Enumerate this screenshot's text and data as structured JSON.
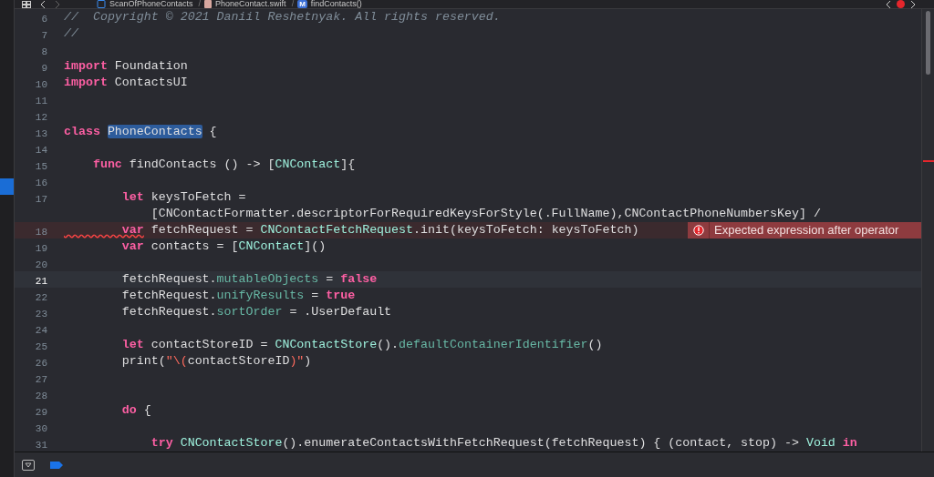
{
  "breadcrumb": {
    "items": [
      {
        "kind": "project",
        "label": "ScanOfPhoneContacts"
      },
      {
        "kind": "file",
        "separator": "/",
        "label": "PhoneContact.swift"
      },
      {
        "kind": "method",
        "separator": "/",
        "symbol": "M",
        "label": "findContacts()"
      }
    ]
  },
  "editor": {
    "rows": [
      {
        "number": "6",
        "current": false,
        "tokens": [
          {
            "kind": "comment",
            "text": "//  Copyright © 2021 Daniil Reshetnyak. All rights reserved."
          }
        ]
      },
      {
        "number": "7",
        "current": false,
        "tokens": [
          {
            "kind": "comment",
            "text": "//"
          }
        ]
      },
      {
        "number": "8",
        "current": false,
        "tokens": []
      },
      {
        "number": "9",
        "current": false,
        "tokens": [
          {
            "kind": "keyword",
            "text": "import"
          },
          {
            "kind": "plain",
            "text": " Foundation"
          }
        ]
      },
      {
        "number": "10",
        "current": false,
        "tokens": [
          {
            "kind": "keyword",
            "text": "import"
          },
          {
            "kind": "plain",
            "text": " ContactsUI"
          }
        ]
      },
      {
        "number": "11",
        "current": false,
        "tokens": []
      },
      {
        "number": "12",
        "current": false,
        "tokens": []
      },
      {
        "number": "13",
        "current": false,
        "tokens": [
          {
            "kind": "keyword",
            "text": "class "
          },
          {
            "kind": "selection",
            "text": "PhoneContacts"
          },
          {
            "kind": "plain",
            "text": " {"
          }
        ]
      },
      {
        "number": "14",
        "current": false,
        "tokens": []
      },
      {
        "number": "15",
        "current": false,
        "tokens": [
          {
            "kind": "keyword",
            "text": "    func"
          },
          {
            "kind": "plain",
            "text": " findContacts () -> ["
          },
          {
            "kind": "type",
            "text": "CNContact"
          },
          {
            "kind": "plain",
            "text": "]{"
          }
        ]
      },
      {
        "number": "16",
        "current": false,
        "tokens": []
      },
      {
        "number": "17",
        "current": false,
        "tokens": [
          {
            "kind": "keyword",
            "text": "        let"
          },
          {
            "kind": "plain",
            "text": " keysToFetch ="
          }
        ],
        "wrapped_tokens": [
          {
            "kind": "plain",
            "text": "            [CNContactFormatter.descriptorForRequiredKeysForStyle(.FullName),CNContactPhoneNumbersKey] /"
          }
        ]
      },
      {
        "number": "18",
        "current": false,
        "error": {
          "message": "Expected expression after operator"
        },
        "tokens": [
          {
            "kind": "keyword",
            "text": "        var"
          },
          {
            "kind": "plain",
            "text": " fetchRequest = "
          },
          {
            "kind": "type",
            "text": "CNContactFetchRequest"
          },
          {
            "kind": "plain",
            "text": ".init(keysToFetch: keysToFetch)"
          }
        ]
      },
      {
        "number": "19",
        "current": false,
        "tokens": [
          {
            "kind": "keyword",
            "text": "        var"
          },
          {
            "kind": "plain",
            "text": " contacts = ["
          },
          {
            "kind": "type",
            "text": "CNContact"
          },
          {
            "kind": "plain",
            "text": "]()"
          }
        ]
      },
      {
        "number": "20",
        "current": false,
        "tokens": []
      },
      {
        "number": "21",
        "current": true,
        "tokens": [
          {
            "kind": "plain",
            "text": "        fetchRequest."
          },
          {
            "kind": "property",
            "text": "mutableObjects"
          },
          {
            "kind": "plain",
            "text": " = "
          },
          {
            "kind": "keyword",
            "text": "false"
          }
        ]
      },
      {
        "number": "22",
        "current": false,
        "tokens": [
          {
            "kind": "plain",
            "text": "        fetchRequest."
          },
          {
            "kind": "property",
            "text": "unifyResults"
          },
          {
            "kind": "plain",
            "text": " = "
          },
          {
            "kind": "keyword",
            "text": "true"
          }
        ]
      },
      {
        "number": "23",
        "current": false,
        "tokens": [
          {
            "kind": "plain",
            "text": "        fetchRequest."
          },
          {
            "kind": "property",
            "text": "sortOrder"
          },
          {
            "kind": "plain",
            "text": " = .UserDefault"
          }
        ]
      },
      {
        "number": "24",
        "current": false,
        "tokens": []
      },
      {
        "number": "25",
        "current": false,
        "tokens": [
          {
            "kind": "keyword",
            "text": "        let"
          },
          {
            "kind": "plain",
            "text": " contactStoreID = "
          },
          {
            "kind": "type",
            "text": "CNContactStore"
          },
          {
            "kind": "plain",
            "text": "()."
          },
          {
            "kind": "property",
            "text": "defaultContainerIdentifier"
          },
          {
            "kind": "plain",
            "text": "()"
          }
        ]
      },
      {
        "number": "26",
        "current": false,
        "tokens": [
          {
            "kind": "plain",
            "text": "        print("
          },
          {
            "kind": "string",
            "text": "\"\\("
          },
          {
            "kind": "plain",
            "text": "contactStoreID"
          },
          {
            "kind": "string",
            "text": ")\""
          },
          {
            "kind": "plain",
            "text": ")"
          }
        ]
      },
      {
        "number": "27",
        "current": false,
        "tokens": []
      },
      {
        "number": "28",
        "current": false,
        "tokens": []
      },
      {
        "number": "29",
        "current": false,
        "tokens": [
          {
            "kind": "keyword",
            "text": "        do"
          },
          {
            "kind": "plain",
            "text": " {"
          }
        ]
      },
      {
        "number": "30",
        "current": false,
        "tokens": []
      },
      {
        "number": "31",
        "current": false,
        "tokens": [
          {
            "kind": "keyword",
            "text": "            try "
          },
          {
            "kind": "type",
            "text": "CNContactStore"
          },
          {
            "kind": "plain",
            "text": "().enumerateContactsWithFetchRequest(fetchRequest) { (contact, stop) -> "
          },
          {
            "kind": "type",
            "text": "Void"
          },
          {
            "kind": "keyword",
            "text": " in"
          }
        ]
      }
    ]
  }
}
